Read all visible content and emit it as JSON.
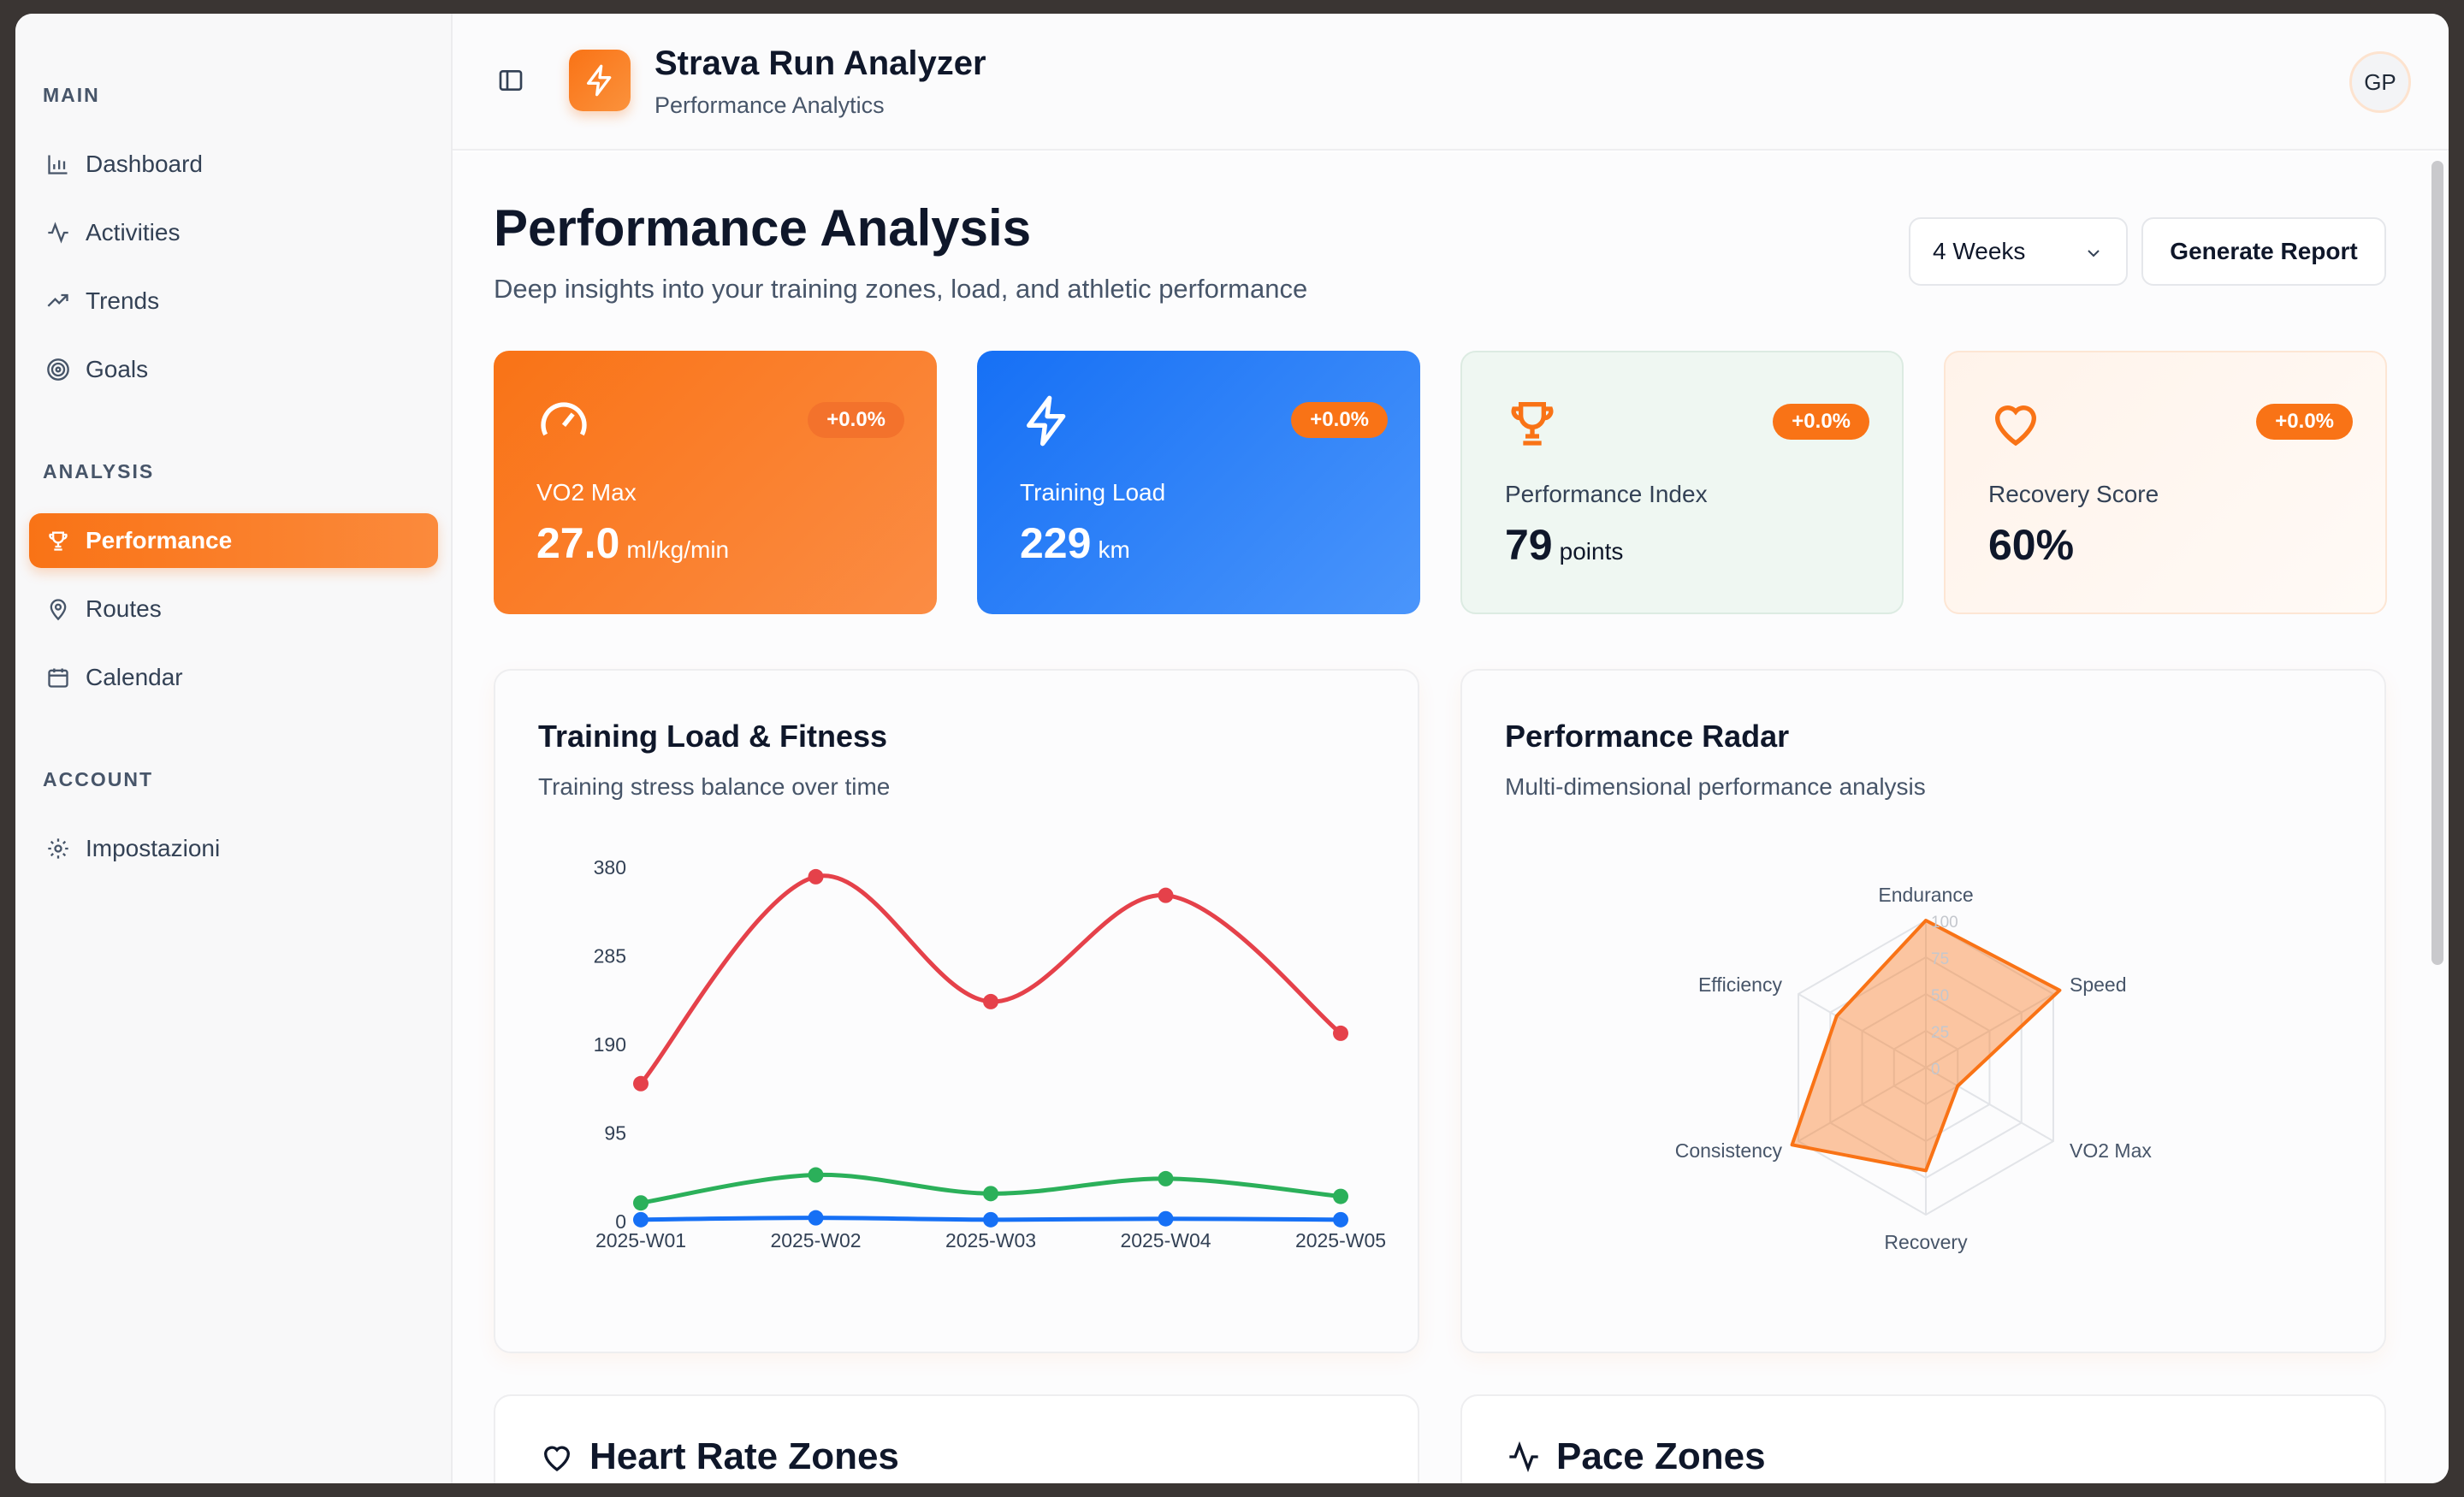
{
  "sidebar": {
    "sections": [
      {
        "title": "MAIN",
        "items": [
          {
            "label": "Dashboard",
            "icon": "bar-chart-icon"
          },
          {
            "label": "Activities",
            "icon": "activity-icon"
          },
          {
            "label": "Trends",
            "icon": "trending-up-icon"
          },
          {
            "label": "Goals",
            "icon": "target-icon"
          }
        ]
      },
      {
        "title": "ANALYSIS",
        "items": [
          {
            "label": "Performance",
            "icon": "trophy-icon",
            "active": true
          },
          {
            "label": "Routes",
            "icon": "map-pin-icon"
          },
          {
            "label": "Calendar",
            "icon": "calendar-icon"
          }
        ]
      },
      {
        "title": "ACCOUNT",
        "items": [
          {
            "label": "Impostazioni",
            "icon": "gear-icon"
          }
        ]
      }
    ]
  },
  "header": {
    "title": "Strava Run Analyzer",
    "subtitle": "Performance Analytics",
    "avatar": "GP"
  },
  "page": {
    "title": "Performance Analysis",
    "subtitle": "Deep insights into your training zones, load, and athletic performance",
    "period_select": "4 Weeks",
    "report_button": "Generate Report"
  },
  "stats": [
    {
      "label": "VO2 Max",
      "value": "27.0",
      "unit": "ml/kg/min",
      "badge": "+0.0%",
      "icon": "gauge-icon"
    },
    {
      "label": "Training Load",
      "value": "229",
      "unit": "km",
      "badge": "+0.0%",
      "icon": "zap-icon"
    },
    {
      "label": "Performance Index",
      "value": "79",
      "unit": "points",
      "badge": "+0.0%",
      "icon": "trophy-icon"
    },
    {
      "label": "Recovery Score",
      "value": "60%",
      "unit": "",
      "badge": "+0.0%",
      "icon": "heart-icon"
    }
  ],
  "cards": {
    "load": {
      "title": "Training Load & Fitness",
      "subtitle": "Training stress balance over time"
    },
    "radar": {
      "title": "Performance Radar",
      "subtitle": "Multi-dimensional performance analysis"
    },
    "hr": {
      "title": "Heart Rate Zones"
    },
    "pace": {
      "title": "Pace Zones"
    }
  },
  "colors": {
    "accent": "#f97316",
    "blue": "#1670f5",
    "red": "#e5414a",
    "green": "#2bb05a"
  },
  "chart_data": [
    {
      "type": "line",
      "categories": [
        "2025-W01",
        "2025-W02",
        "2025-W03",
        "2025-W04",
        "2025-W05"
      ],
      "yticks": [
        0,
        95,
        190,
        285,
        380
      ],
      "ylim": [
        0,
        380
      ],
      "series": [
        {
          "color": "#e5414a",
          "values": [
            148,
            370,
            236,
            350,
            202
          ]
        },
        {
          "color": "#2bb05a",
          "values": [
            20,
            50,
            30,
            46,
            27
          ]
        },
        {
          "color": "#1670f5",
          "values": [
            2,
            4,
            2,
            3,
            2
          ]
        }
      ]
    },
    {
      "type": "radar",
      "axes": [
        "Endurance",
        "Speed",
        "VO2 Max",
        "Recovery",
        "Consistency",
        "Efficiency"
      ],
      "rticks": [
        0,
        25,
        50,
        75,
        100
      ],
      "series": [
        {
          "color": "#f97316",
          "values": [
            100,
            105,
            25,
            70,
            105,
            70
          ]
        }
      ]
    }
  ]
}
